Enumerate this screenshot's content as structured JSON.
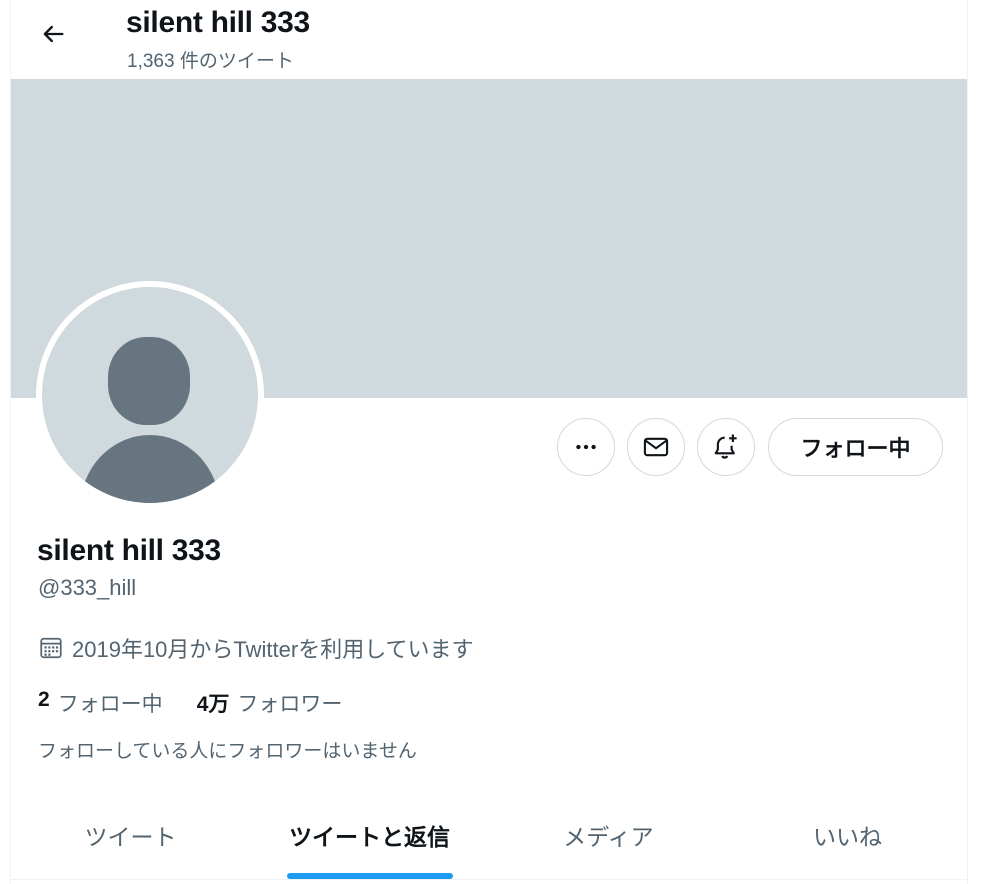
{
  "header": {
    "back_icon": "arrow-left-icon",
    "title": "silent hill 333",
    "tweet_count": "1,363 件のツイート"
  },
  "colors": {
    "banner": "#cfd9de",
    "accent": "#1d9bf0",
    "text_primary": "#0f1419",
    "text_secondary": "#536471"
  },
  "actions": {
    "more_icon": "more-dots-icon",
    "message_icon": "envelope-icon",
    "notify_icon": "bell-plus-icon",
    "follow_label": "フォロー中"
  },
  "profile": {
    "display_name": "silent hill 333",
    "handle": "@333_hill",
    "joined_icon": "calendar-icon",
    "joined": "2019年10月からTwitterを利用しています",
    "following_count": "2",
    "following_label": "フォロー中",
    "followers_count": "4万",
    "followers_label": "フォロワー",
    "no_followers_you_know": "フォローしている人にフォロワーはいません"
  },
  "tabs": [
    {
      "label": "ツイート",
      "active": false
    },
    {
      "label": "ツイートと返信",
      "active": true
    },
    {
      "label": "メディア",
      "active": false
    },
    {
      "label": "いいね",
      "active": false
    }
  ]
}
